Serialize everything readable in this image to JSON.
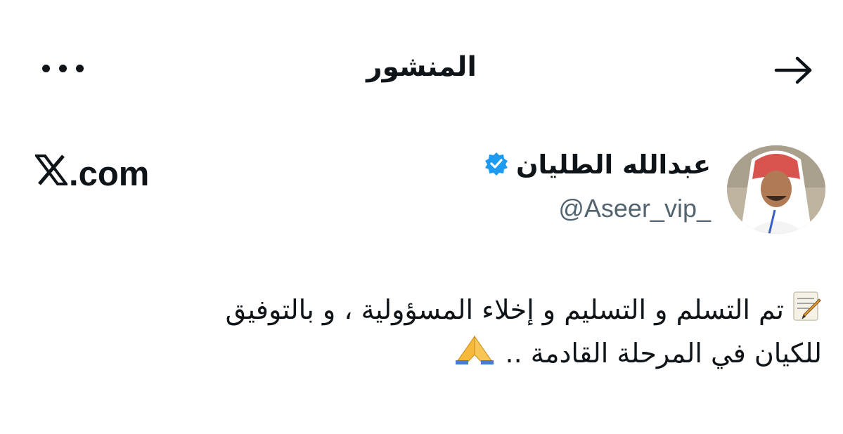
{
  "header": {
    "title": "المنشور",
    "back_icon": "arrow-right-icon",
    "more_icon": "more-dots-icon"
  },
  "author": {
    "name": "عبدالله الطليان",
    "handle": "@Aseer_vip_",
    "verified": true,
    "avatar_icon": "avatar-photo"
  },
  "brand": {
    "site": ".com",
    "logo_icon": "x-logo-icon"
  },
  "post": {
    "line1": "تم التسلم و التسليم و إخلاء المسؤولية ، و بالتوفيق",
    "line2": "للكيان في المرحلة القادمة ..",
    "emoji_memo": "memo-emoji-icon",
    "emoji_pray": "folded-hands-emoji-icon"
  },
  "colors": {
    "text": "#0f1419",
    "secondary": "#536471",
    "verified_badge": "#1d9bf0"
  }
}
